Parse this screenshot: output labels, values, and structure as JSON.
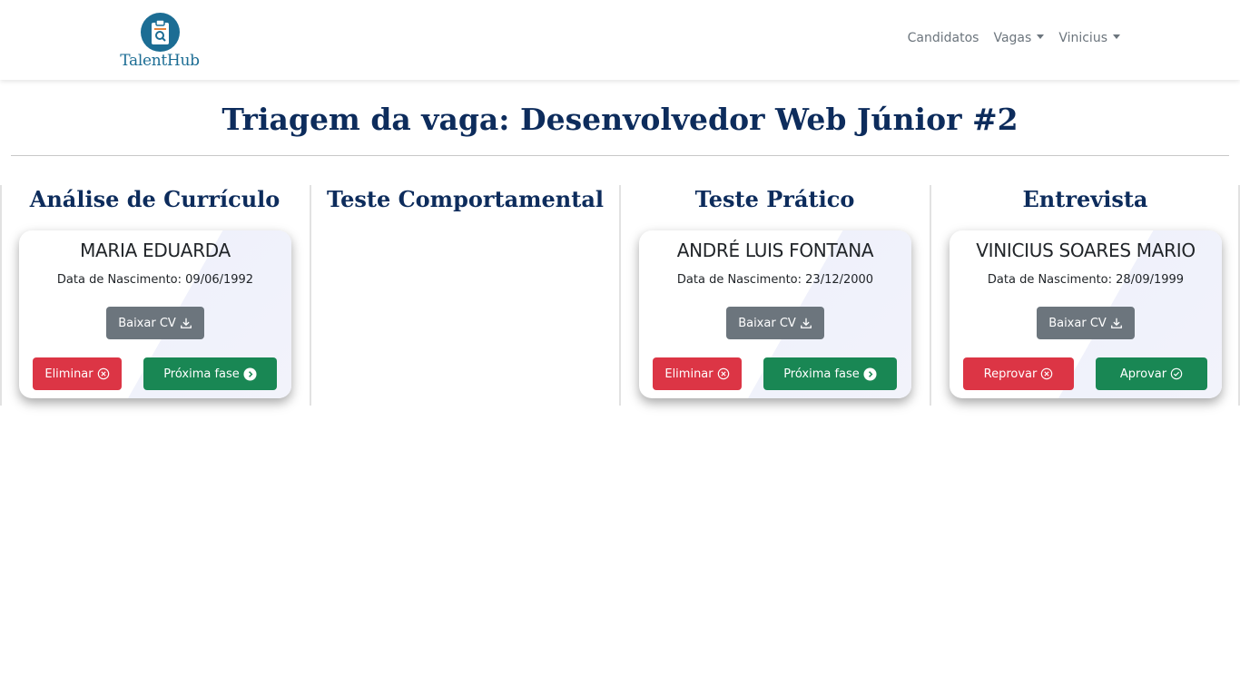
{
  "brand": {
    "name": "TalentHub"
  },
  "nav": {
    "items": [
      {
        "label": "Candidatos",
        "dropdown": false
      },
      {
        "label": "Vagas",
        "dropdown": true
      },
      {
        "label": "Vinicius",
        "dropdown": true
      }
    ]
  },
  "page": {
    "title": "Triagem da vaga: Desenvolvedor Web Júnior #2"
  },
  "columns": [
    {
      "title": "Análise de Currículo",
      "cards": [
        {
          "name": "MARIA EDUARDA",
          "birth": "Data de Nascimento: 09/06/1992",
          "cv_label": "Baixar CV",
          "reject_label": "Eliminar",
          "advance_label": "Próxima fase"
        }
      ]
    },
    {
      "title": "Teste Comportamental",
      "cards": []
    },
    {
      "title": "Teste Prático",
      "cards": [
        {
          "name": "ANDRÉ LUIS FONTANA",
          "birth": "Data de Nascimento: 23/12/2000",
          "cv_label": "Baixar CV",
          "reject_label": "Eliminar",
          "advance_label": "Próxima fase"
        }
      ]
    },
    {
      "title": "Entrevista",
      "cards": [
        {
          "name": "VINICIUS SOARES MARIO",
          "birth": "Data de Nascimento: 28/09/1999",
          "cv_label": "Baixar CV",
          "reject_label": "Reprovar",
          "advance_label": "Aprovar"
        }
      ]
    }
  ],
  "colors": {
    "title": "#0d2c5c",
    "brand": "#1c6d94",
    "danger": "#dc3545",
    "success": "#198754",
    "secondary": "#6c757d"
  },
  "icons": {
    "cv": "download-icon",
    "reject": "x-circle-icon",
    "advance": "arrow-right-circle-icon",
    "approve": "check-circle-icon"
  }
}
